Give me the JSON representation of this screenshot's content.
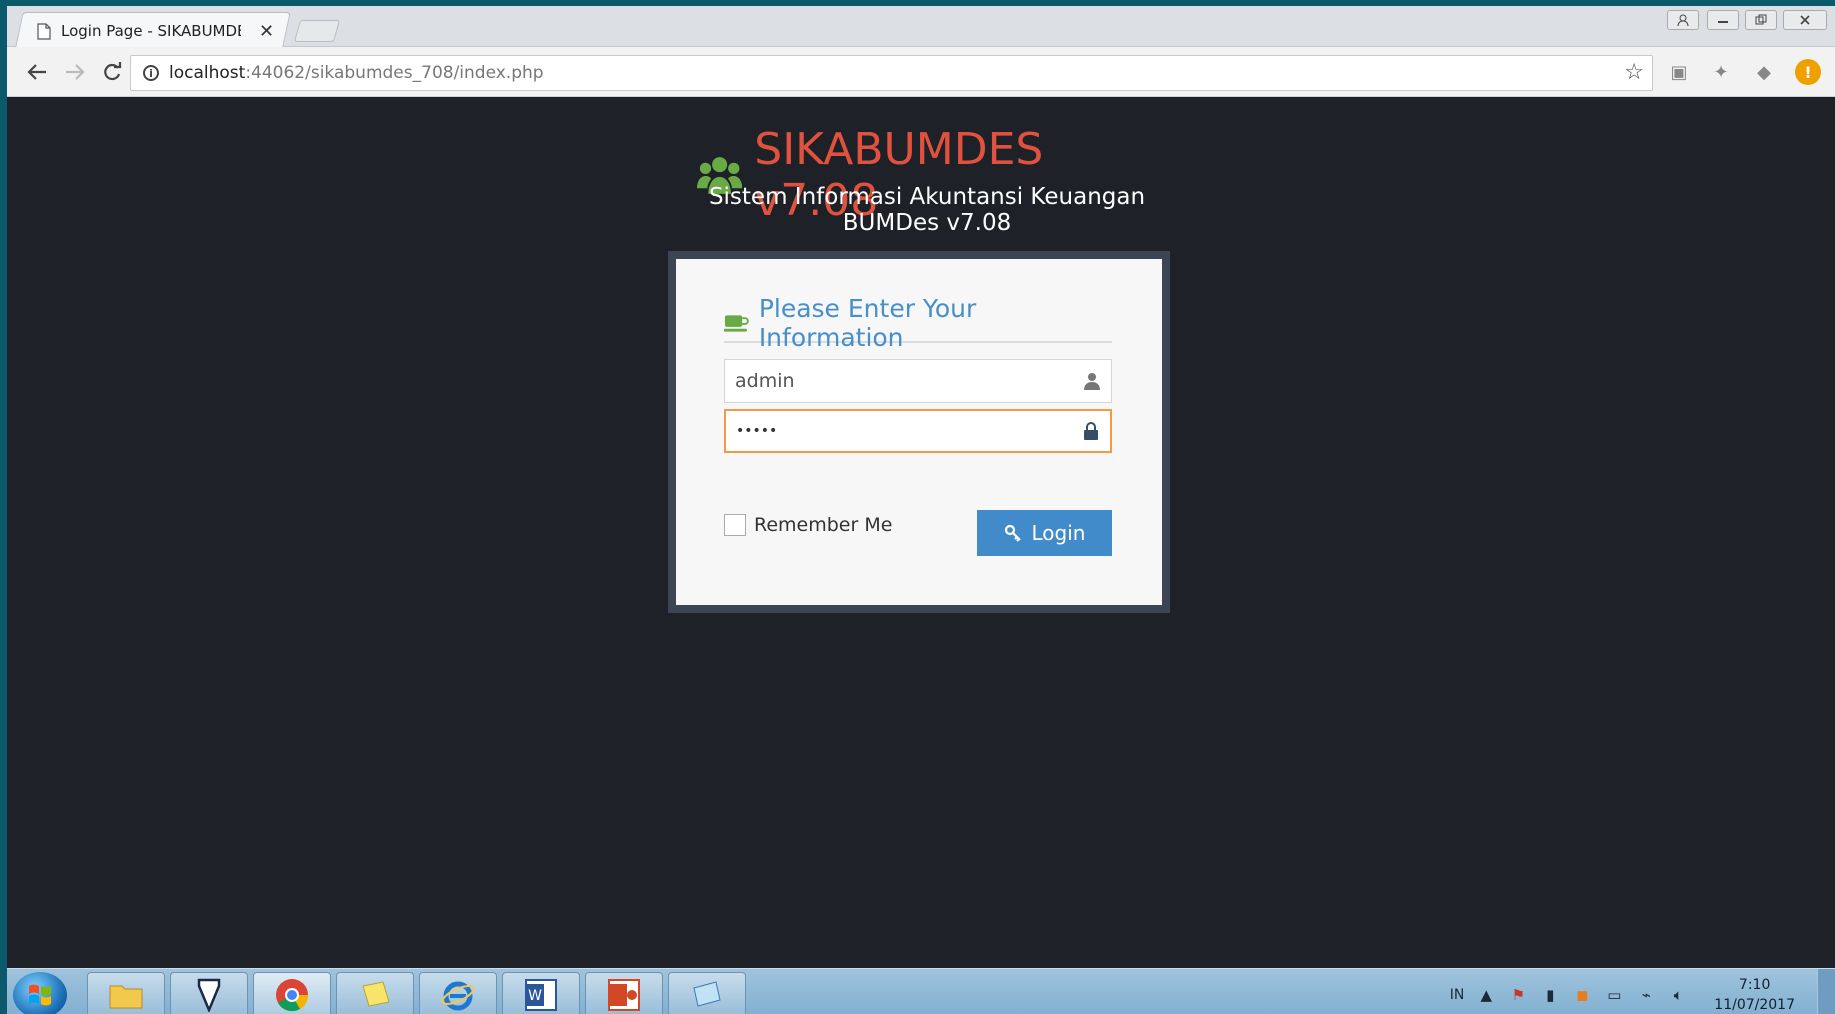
{
  "browser": {
    "tab_title": "Login Page - SIKABUMDES",
    "tab_close": "✕",
    "url_host": "localhost",
    "url_rest": ":44062/sikabumdes_708/index.php"
  },
  "page": {
    "brand_title": "SIKABUMDES v7.08",
    "subtitle_line1": "Sistem Informasi Akuntansi Keuangan",
    "subtitle_line2": "BUMDes v7.08"
  },
  "login": {
    "header": "Please Enter Your Information",
    "username_value": "admin",
    "password_value": "•••••",
    "remember_label": "Remember Me",
    "login_label": "Login"
  },
  "taskbar": {
    "lang": "IN",
    "time": "7:10",
    "date": "11/07/2017"
  },
  "colors": {
    "brand": "#e0523d",
    "header_text": "#478fca",
    "button": "#428bca",
    "focus_border": "#f59942",
    "page_bg": "#1e2127"
  }
}
